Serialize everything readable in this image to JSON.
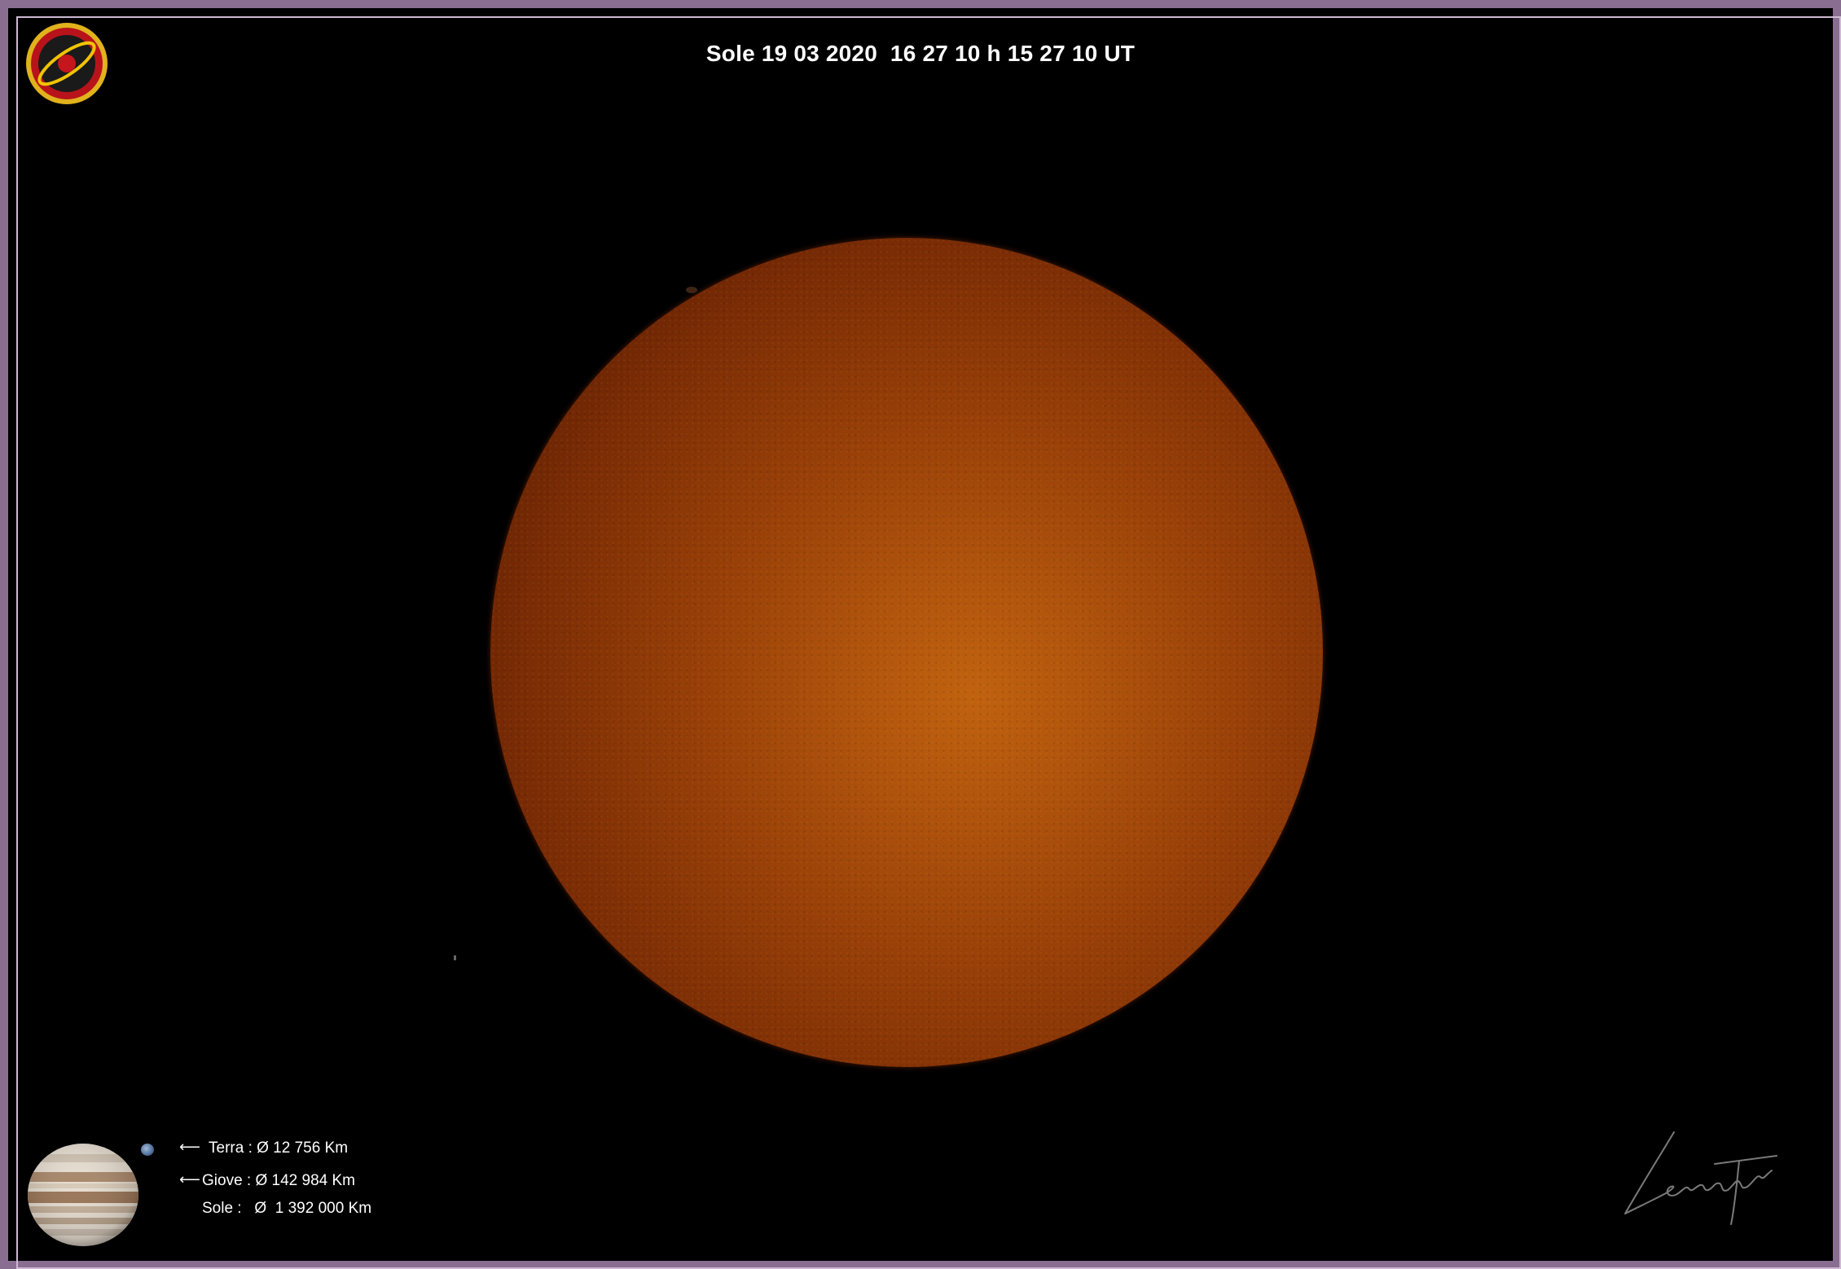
{
  "title": "Sole 19 03 2020  16 27 10 h 15 27 10 UT",
  "legend": {
    "terra": "Terra : Ø 12 756 Km",
    "giove": "Giove : Ø 142 984 Km",
    "sole": "Sole :   Ø  1 392 000 Km"
  },
  "icons": {
    "logo": "observatory-badge-icon",
    "arrow": "arrow-left-icon",
    "jupiter": "jupiter-icon",
    "earth": "earth-icon"
  },
  "colors": {
    "frame": "#8a6e92",
    "sun_center": "#c0620f",
    "sun_edge": "#3e1102",
    "background": "#000000"
  }
}
